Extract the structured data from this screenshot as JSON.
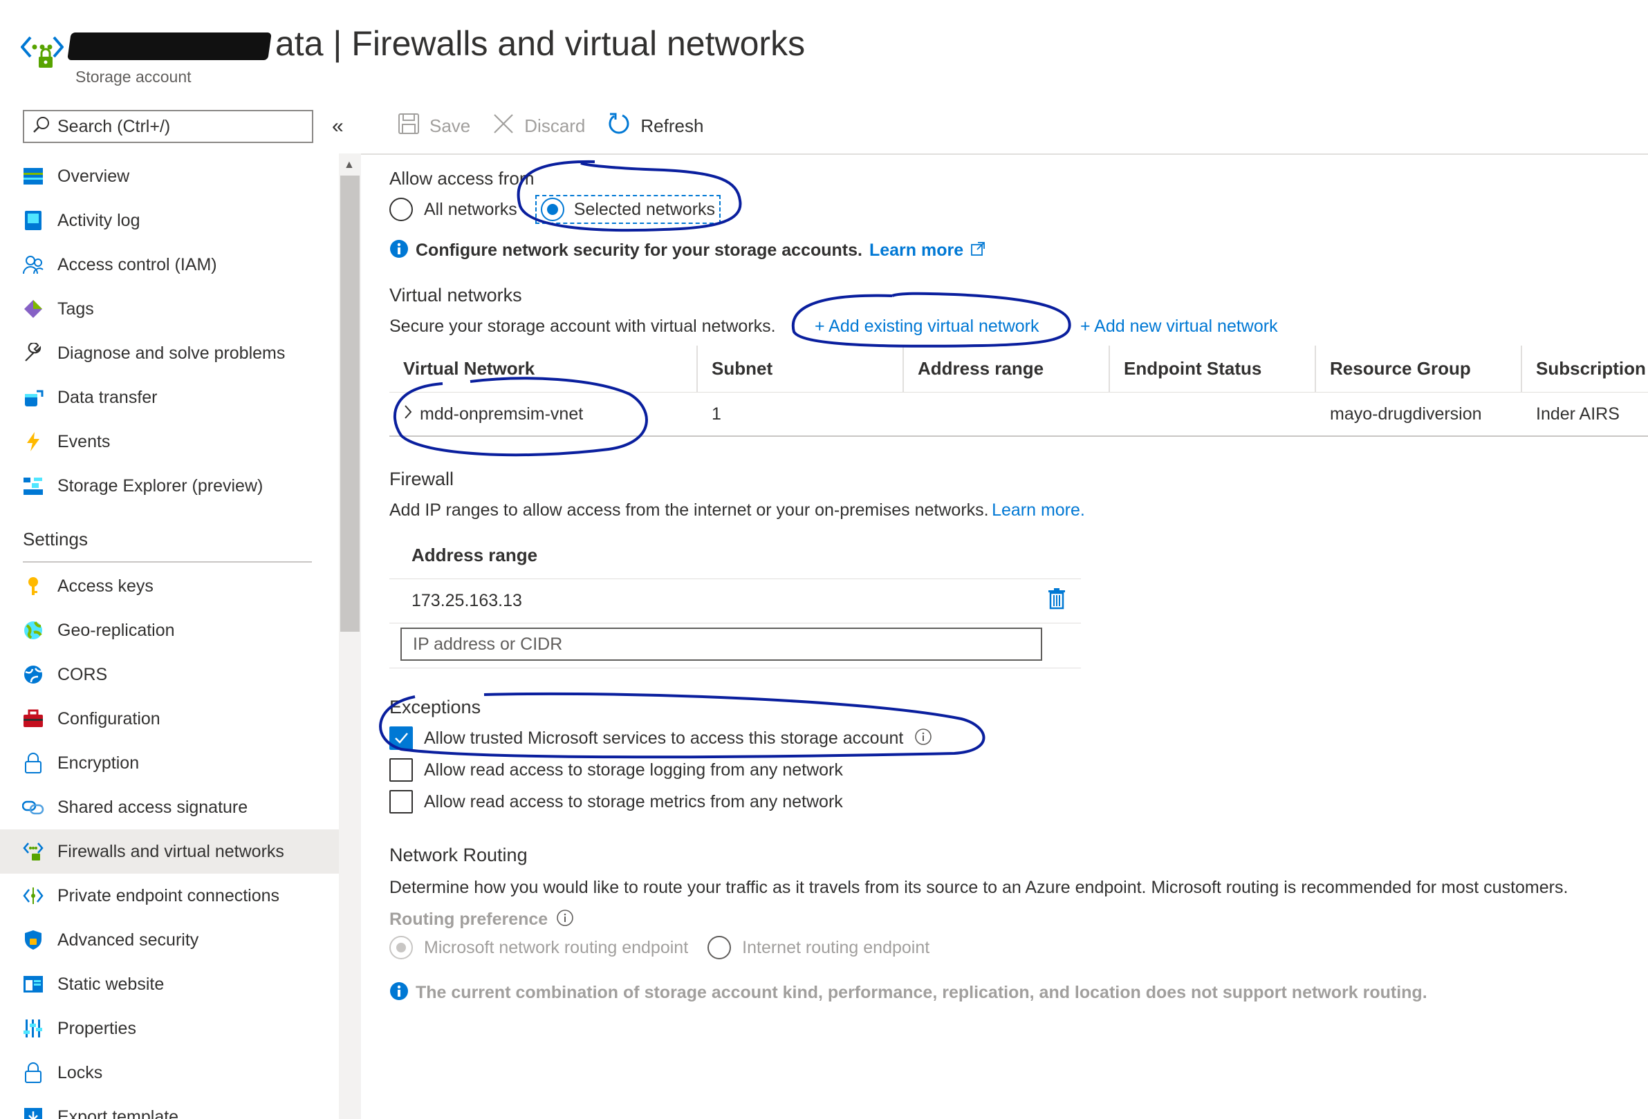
{
  "header": {
    "title": "ata | Firewalls and virtual networks",
    "subtitle": "Storage account"
  },
  "search": {
    "placeholder": "Search (Ctrl+/)"
  },
  "sidebar": {
    "collapse_icon": "«",
    "items": [
      {
        "label": "Overview",
        "icon": "overview-icon"
      },
      {
        "label": "Activity log",
        "icon": "activity-log-icon"
      },
      {
        "label": "Access control (IAM)",
        "icon": "people-icon"
      },
      {
        "label": "Tags",
        "icon": "tag-icon"
      },
      {
        "label": "Diagnose and solve problems",
        "icon": "wrench-icon"
      },
      {
        "label": "Data transfer",
        "icon": "data-transfer-icon"
      },
      {
        "label": "Events",
        "icon": "lightning-icon"
      },
      {
        "label": "Storage Explorer (preview)",
        "icon": "storage-explorer-icon"
      }
    ],
    "settings_heading": "Settings",
    "settings_items": [
      {
        "label": "Access keys",
        "icon": "key-icon"
      },
      {
        "label": "Geo-replication",
        "icon": "globe-icon"
      },
      {
        "label": "CORS",
        "icon": "cors-icon"
      },
      {
        "label": "Configuration",
        "icon": "toolbox-icon"
      },
      {
        "label": "Encryption",
        "icon": "lock-icon"
      },
      {
        "label": "Shared access signature",
        "icon": "link-icon"
      },
      {
        "label": "Firewalls and virtual networks",
        "icon": "firewall-icon",
        "active": true
      },
      {
        "label": "Private endpoint connections",
        "icon": "private-endpoint-icon"
      },
      {
        "label": "Advanced security",
        "icon": "shield-icon"
      },
      {
        "label": "Static website",
        "icon": "website-icon"
      },
      {
        "label": "Properties",
        "icon": "properties-icon"
      },
      {
        "label": "Locks",
        "icon": "lock-icon"
      },
      {
        "label": "Export template",
        "icon": "export-icon"
      }
    ]
  },
  "toolbar": {
    "save_label": "Save",
    "discard_label": "Discard",
    "refresh_label": "Refresh"
  },
  "access": {
    "label": "Allow access from",
    "option_all": "All networks",
    "option_selected": "Selected networks",
    "selected": "Selected networks"
  },
  "info": {
    "text": "Configure network security for your storage accounts.",
    "link": "Learn more"
  },
  "vnets": {
    "title": "Virtual networks",
    "desc": "Secure your storage account with virtual networks.",
    "add_existing": "+ Add existing virtual network",
    "add_new": "+ Add new virtual network",
    "columns": [
      "Virtual Network",
      "Subnet",
      "Address range",
      "Endpoint Status",
      "Resource Group",
      "Subscription"
    ],
    "rows": [
      {
        "name": "mdd-onpremsim-vnet",
        "subnet": "1",
        "address_range": "",
        "endpoint_status": "",
        "resource_group": "mayo-drugdiversion",
        "subscription": "Inder AIRS"
      }
    ]
  },
  "firewall": {
    "title": "Firewall",
    "desc": "Add IP ranges to allow access from the internet or your on-premises networks.",
    "link": "Learn more.",
    "column": "Address range",
    "ranges": [
      "173.25.163.13"
    ],
    "input_placeholder": "IP address or CIDR"
  },
  "exceptions": {
    "title": "Exceptions",
    "items": [
      {
        "label": "Allow trusted Microsoft services to access this storage account",
        "checked": true
      },
      {
        "label": "Allow read access to storage logging from any network",
        "checked": false
      },
      {
        "label": "Allow read access to storage metrics from any network",
        "checked": false
      }
    ]
  },
  "routing": {
    "title": "Network Routing",
    "desc": "Determine how you would like to route your traffic as it travels from its source to an Azure endpoint. Microsoft routing is recommended for most customers.",
    "pref_label": "Routing preference",
    "option_microsoft": "Microsoft network routing endpoint",
    "option_internet": "Internet routing endpoint",
    "notice": "The current combination of storage account kind, performance, replication, and location does not support network routing."
  },
  "colors": {
    "accent": "#0078d4",
    "annotation": "#0a1f9e",
    "active_nav": "#edebe9"
  }
}
